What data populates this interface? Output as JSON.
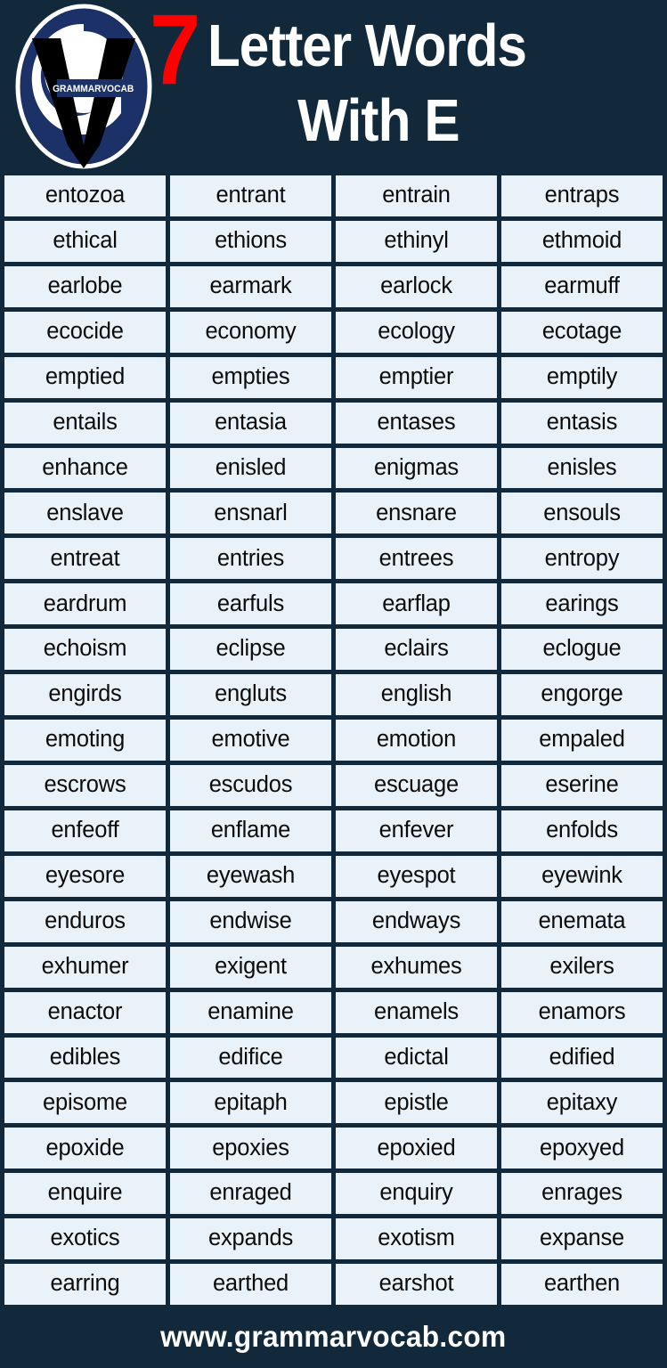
{
  "header": {
    "logo": {
      "name": "grammarvocab-logo",
      "banner_text": "GRAMMARVOCAB",
      "oval_color": "#1b3168",
      "letter_color": "#000000"
    },
    "number": "7",
    "number_color": "#ff0000",
    "title_line1": "Letter Words",
    "title_line2": "With E",
    "background_color": "#12293c",
    "text_color": "#ffffff"
  },
  "grid": {
    "columns": 4,
    "rows": 24,
    "cell_background": "#e9f2f8",
    "cell_text_color": "#0b0b0b",
    "words": [
      [
        "entozoa",
        "entrant",
        "entrain",
        "entraps"
      ],
      [
        "ethical",
        "ethions",
        "ethinyl",
        "ethmoid"
      ],
      [
        "earlobe",
        "earmark",
        "earlock",
        "earmuff"
      ],
      [
        "ecocide",
        "economy",
        "ecology",
        "ecotage"
      ],
      [
        "emptied",
        "empties",
        "emptier",
        "emptily"
      ],
      [
        "entails",
        "entasia",
        "entases",
        "entasis"
      ],
      [
        "enhance",
        "enisled",
        "enigmas",
        "enisles"
      ],
      [
        "enslave",
        "ensnarl",
        "ensnare",
        "ensouls"
      ],
      [
        "entreat",
        "entries",
        "entrees",
        "entropy"
      ],
      [
        "eardrum",
        "earfuls",
        "earflap",
        "earings"
      ],
      [
        "echoism",
        "eclipse",
        "eclairs",
        "eclogue"
      ],
      [
        "engirds",
        "engluts",
        "english",
        "engorge"
      ],
      [
        "emoting",
        "emotive",
        "emotion",
        "empaled"
      ],
      [
        "escrows",
        "escudos",
        "escuage",
        "eserine"
      ],
      [
        "enfeoff",
        "enflame",
        "enfever",
        "enfolds"
      ],
      [
        "eyesore",
        "eyewash",
        "eyespot",
        "eyewink"
      ],
      [
        "enduros",
        "endwise",
        "endways",
        "enemata"
      ],
      [
        "exhumer",
        "exigent",
        "exhumes",
        "exilers"
      ],
      [
        "enactor",
        "enamine",
        "enamels",
        "enamors"
      ],
      [
        "edibles",
        "edifice",
        "edictal",
        "edified"
      ],
      [
        "episome",
        "epitaph",
        "epistle",
        "epitaxy"
      ],
      [
        "epoxide",
        "epoxies",
        "epoxied",
        "epoxyed"
      ],
      [
        "enquire",
        "enraged",
        "enquiry",
        "enrages"
      ],
      [
        "exotics",
        "expands",
        "exotism",
        "expanse"
      ],
      [
        "earring",
        "earthed",
        "earshot",
        "earthen"
      ]
    ]
  },
  "footer": {
    "website": "www.grammarvocab.com",
    "background_color": "#12293c",
    "text_color": "#ffffff"
  }
}
